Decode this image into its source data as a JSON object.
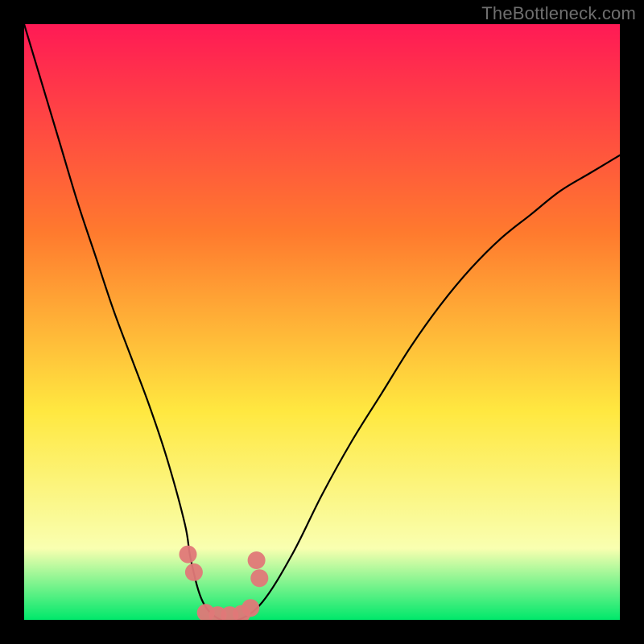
{
  "watermark": "TheBottleneck.com",
  "colors": {
    "frame": "#000000",
    "gradient_top": "#ff1a55",
    "gradient_mid1": "#ff7a2e",
    "gradient_mid2": "#ffe840",
    "gradient_low": "#f9ffb0",
    "gradient_bottom": "#00e86b",
    "curve": "#000000",
    "marker": "#e07878"
  },
  "chart_data": {
    "type": "line",
    "title": "",
    "xlabel": "",
    "ylabel": "",
    "axis_ranges": {
      "x": [
        0,
        100
      ],
      "y": [
        0,
        100
      ]
    },
    "grid": false,
    "legend": null,
    "note": "No axis ticks or labels are rendered in the image; x/y are relative 0–100 percentages of the plot area, with y=0 at the bottom (green) and y=100 at the top (red). Values estimated from pixel positions.",
    "series": [
      {
        "name": "bottleneck-curve",
        "color": "#000000",
        "x": [
          0,
          3,
          6,
          9,
          12,
          15,
          18,
          21,
          24,
          27,
          28,
          30,
          33,
          36,
          40,
          45,
          50,
          55,
          60,
          65,
          70,
          75,
          80,
          85,
          90,
          95,
          100
        ],
        "y": [
          100,
          90,
          80,
          70,
          61,
          52,
          44,
          36,
          27,
          16,
          10,
          3,
          0,
          0,
          3,
          11,
          21,
          30,
          38,
          46,
          53,
          59,
          64,
          68,
          72,
          75,
          78
        ]
      }
    ],
    "markers": [
      {
        "name": "left-cluster",
        "shape": "circle",
        "color": "#e07878",
        "points": [
          {
            "x": 27.5,
            "y": 11
          },
          {
            "x": 28.5,
            "y": 8
          }
        ]
      },
      {
        "name": "right-cluster",
        "shape": "circle",
        "color": "#e07878",
        "points": [
          {
            "x": 39.0,
            "y": 10
          },
          {
            "x": 39.5,
            "y": 7
          }
        ]
      },
      {
        "name": "bottom-cluster",
        "shape": "circle",
        "color": "#e07878",
        "points": [
          {
            "x": 30.5,
            "y": 1.2
          },
          {
            "x": 32.5,
            "y": 0.8
          },
          {
            "x": 34.5,
            "y": 0.8
          },
          {
            "x": 36.5,
            "y": 1.0
          },
          {
            "x": 38.0,
            "y": 2.0
          }
        ]
      }
    ],
    "gradient_stops_y_percent_from_top": [
      {
        "offset": 0,
        "color": "#ff1a55"
      },
      {
        "offset": 35,
        "color": "#ff7a2e"
      },
      {
        "offset": 65,
        "color": "#ffe840"
      },
      {
        "offset": 88,
        "color": "#f9ffb0"
      },
      {
        "offset": 100,
        "color": "#00e86b"
      }
    ]
  }
}
